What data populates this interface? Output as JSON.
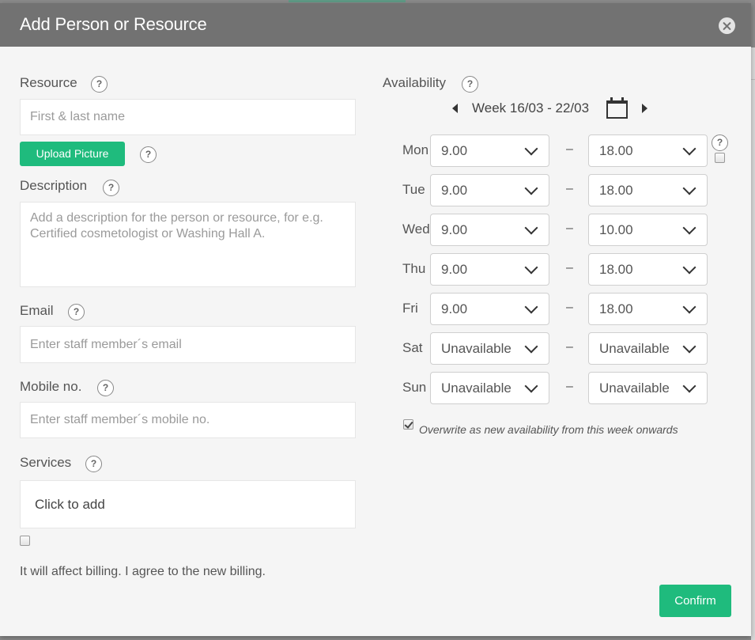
{
  "dialog": {
    "title": "Add Person or Resource",
    "close_icon": "close-icon"
  },
  "resource": {
    "label": "Resource",
    "placeholder": "First & last name",
    "upload_label": "Upload Picture"
  },
  "description": {
    "label": "Description",
    "placeholder": "Add a description for the person or resource, for e.g. Certified cosmetologist or Washing Hall A."
  },
  "email": {
    "label": "Email",
    "placeholder": "Enter staff member´s email"
  },
  "mobile": {
    "label": "Mobile no.",
    "placeholder": "Enter staff member´s mobile no."
  },
  "services": {
    "label": "Services",
    "value": "Click to add"
  },
  "billing": {
    "checked": false,
    "text": "It will affect billing. I agree to the new billing."
  },
  "help_icon_glyph": "?",
  "availability": {
    "label": "Availability",
    "week_label": "Week 16/03 - 22/03",
    "separator": "–",
    "days": [
      {
        "day": "Mon",
        "from": "9.00",
        "to": "18.00"
      },
      {
        "day": "Tue",
        "from": "9.00",
        "to": "18.00"
      },
      {
        "day": "Wed",
        "from": "9.00",
        "to": "10.00"
      },
      {
        "day": "Thu",
        "from": "9.00",
        "to": "18.00"
      },
      {
        "day": "Fri",
        "from": "9.00",
        "to": "18.00"
      },
      {
        "day": "Sat",
        "from": "Unavailable",
        "to": "Unavailable"
      },
      {
        "day": "Sun",
        "from": "Unavailable",
        "to": "Unavailable"
      }
    ],
    "overwrite": {
      "checked": true,
      "text": "Overwrite as new availability from this week onwards"
    }
  },
  "confirm_label": "Confirm",
  "colors": {
    "header": "#727272",
    "accent": "#1fbb7d",
    "background": "#f5f5f5"
  }
}
